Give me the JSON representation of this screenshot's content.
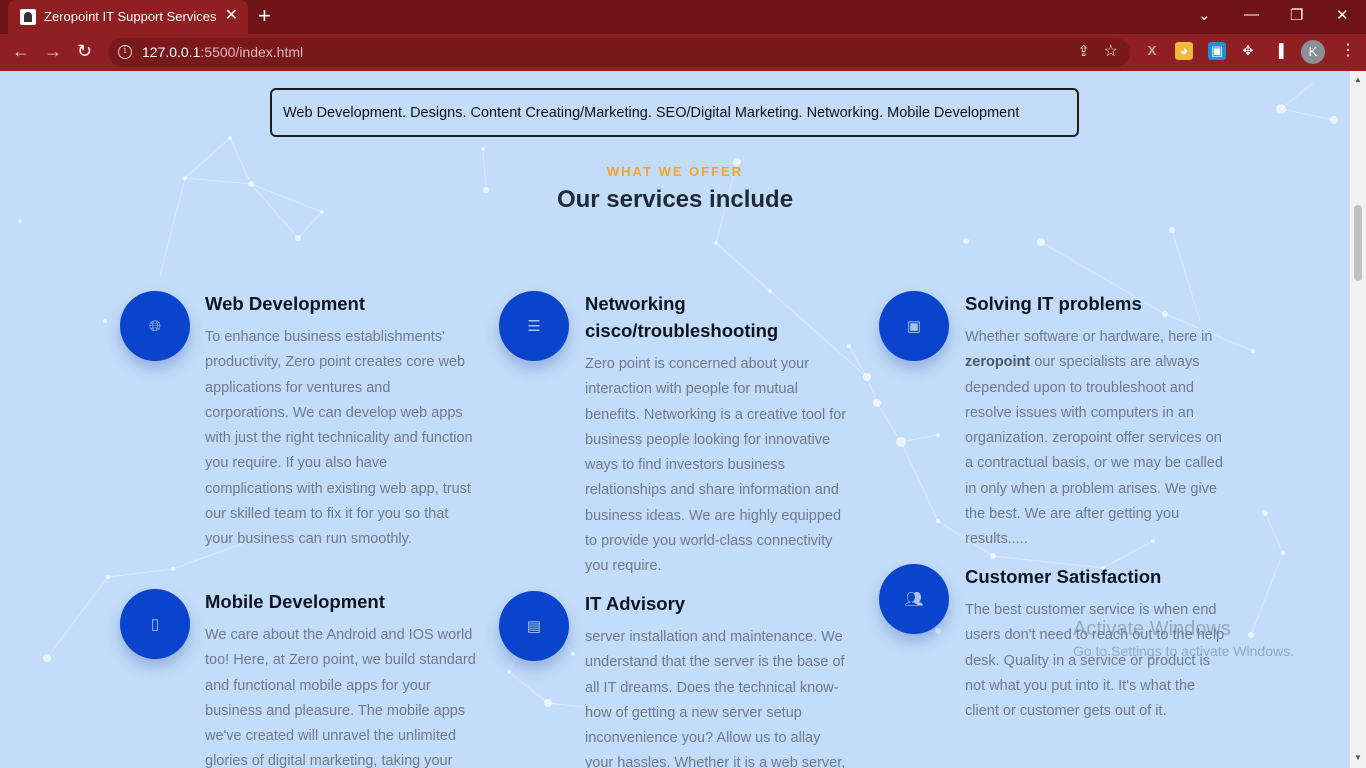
{
  "browser": {
    "tab_title": "Zeropoint IT Support Services",
    "tab_close": "✕",
    "new_tab": "+",
    "url_host": "127.0.0.1",
    "url_rest": ":5500/index.html",
    "profile_initial": "K",
    "icons": [
      "back-icon",
      "forward-icon",
      "reload-icon",
      "info-icon",
      "share-icon",
      "star-icon",
      "extensions-icon",
      "sidebar-icon",
      "menu-icon"
    ]
  },
  "tagline": "Web Development. Designs. Content Creating/Marketing. SEO/Digital Marketing. Networking. Mobile Development",
  "section": {
    "eyebrow": "WHAT WE OFFER",
    "heading": "Our services include"
  },
  "services": {
    "web": {
      "title": "Web Development",
      "desc": "To enhance business establishments' productivity, Zero point creates core web applications for ventures and corporations. We can develop web apps with just the right technicality and function you require. If you also have complications with existing web app, trust our skilled team to fix it for you so that your business can run smoothly.",
      "icon": "globe-icon"
    },
    "networking": {
      "title": "Networking cisco/troubleshooting",
      "desc": "Zero point is concerned about your interaction with people for mutual benefits. Networking is a creative tool for business people looking for innovative ways to find investors business relationships and share information and business ideas. We are highly equipped to provide you world-class connectivity you require.",
      "icon": "server-icon"
    },
    "solving": {
      "title": "Solving IT problems",
      "desc_before": "Whether software or hardware, here in ",
      "desc_bold": "zeropoint",
      "desc_after": " our specialists are always depended upon to troubleshoot and resolve issues with computers in an organization. zeropoint offer services on a contractual basis, or we may be called in only when a problem arises. We give the best. We are after getting you results.....",
      "icon": "chip-icon"
    },
    "mobile": {
      "title": "Mobile Development",
      "desc": "We care about the Android and IOS world too! Here, at Zero point, we build standard and functional mobile apps for your business and pleasure. The mobile apps we've created will unravel the unlimited glories of digital marketing, taking your",
      "icon": "mobile-icon"
    },
    "advisory": {
      "title": "IT Advisory",
      "desc": "server installation and maintenance. We understand that the server is the base of all IT dreams. Does the technical know-how of getting a new server setup inconvenience you? Allow us to allay your hassles. Whether it is a web server, mail",
      "icon": "notebook-icon"
    },
    "satisfaction": {
      "title": "Customer Satisfaction",
      "desc": "The best customer service is when end users don't need to reach out to the help desk. Quality in a service or product is not what you put into it. It's what the client or customer gets out of it.",
      "icon": "users-icon"
    }
  },
  "watermark": {
    "line1": "Activate Windows",
    "line2": "Go to Settings to activate Windows."
  },
  "colors": {
    "accent": "#f4a524",
    "icon_circle": "#0a44cc",
    "page_bg": "#c3dcfa",
    "browser_frame": "#6e1417"
  }
}
